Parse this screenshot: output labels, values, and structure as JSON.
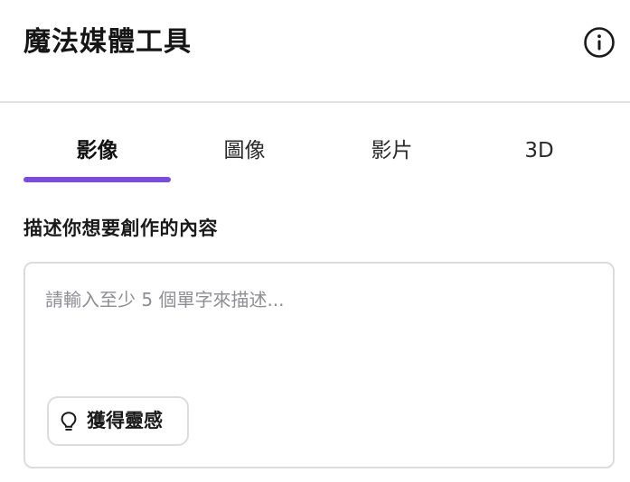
{
  "header": {
    "title": "魔法媒體工具",
    "info_icon": "info-icon"
  },
  "tabs": [
    {
      "label": "影像",
      "active": true
    },
    {
      "label": "圖像",
      "active": false
    },
    {
      "label": "影片",
      "active": false
    },
    {
      "label": "3D",
      "active": false
    }
  ],
  "prompt": {
    "label": "描述你想要創作的內容",
    "placeholder": "請輸入至少 5 個單字來描述...",
    "value": "",
    "inspire_button": {
      "label": "獲得靈感",
      "icon": "lightbulb-icon"
    }
  },
  "colors": {
    "accent": "#7b4be0",
    "border": "#dcdce0",
    "placeholder": "#8e8e93"
  }
}
